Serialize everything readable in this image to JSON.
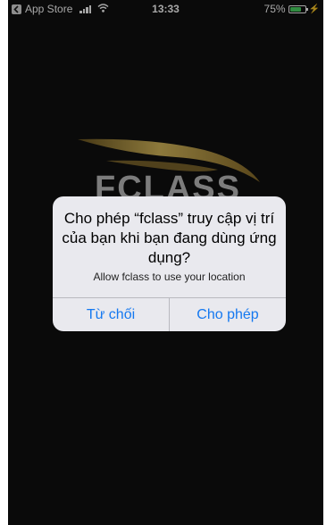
{
  "status_bar": {
    "back_app": "App Store",
    "time": "13:33",
    "battery_percent": "75%",
    "battery_level": 0.75
  },
  "brand": {
    "logo_text": "FCLASS",
    "gold_color": "#c9a94a",
    "icon": "fclass-wing-logo"
  },
  "alert": {
    "title": "Cho phép “fclass” truy cập vị trí của bạn khi bạn đang dùng ứng dụng?",
    "message": "Allow fclass to use your location",
    "deny_label": "Từ chối",
    "allow_label": "Cho phép",
    "button_color": "#1478f0"
  }
}
